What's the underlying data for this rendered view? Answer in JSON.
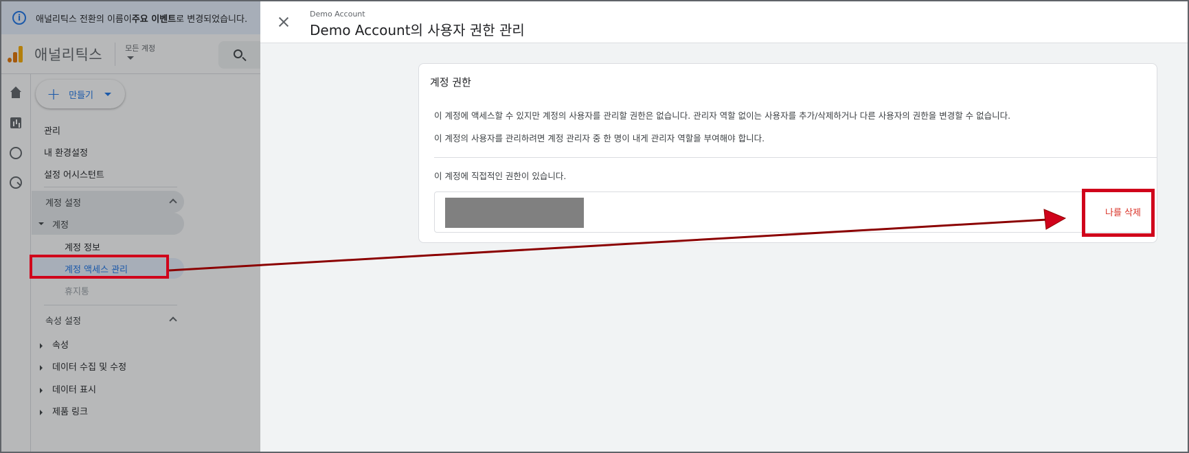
{
  "banner": {
    "text_before": "애널리틱스 전환의 이름이 ",
    "text_bold": "주요 이벤트",
    "text_after": "로 변경되었습니다."
  },
  "topbar": {
    "app_name": "애널리틱스",
    "account_selector_label": "모든 계정"
  },
  "create_button": {
    "label": "만들기"
  },
  "sidebar": {
    "admin": "관리",
    "my_preferences": "내 환경설정",
    "setup_assistant": "설정 어시스턴트",
    "account_settings": "계정 설정",
    "account": "계정",
    "account_details": "계정 정보",
    "account_access_management": "계정 액세스 관리",
    "trash": "휴지통",
    "property_settings": "속성 설정",
    "property": "속성",
    "data_collection": "데이터 수집 및 수정",
    "data_display": "데이터 표시",
    "product_links": "제품 링크"
  },
  "panel": {
    "subtitle": "Demo Account",
    "title": "Demo Account의 사용자 권한 관리"
  },
  "card": {
    "title": "계정 권한",
    "line1": "이 계정에 액세스할 수 있지만 계정의 사용자를 관리할 권한은 없습니다. 관리자 역할 없이는 사용자를 추가/삭제하거나 다른 사용자의 권한을 변경할 수 없습니다.",
    "line2": "이 계정의 사용자를 관리하려면 계정 관리자 중 한 명이 내게 관리자 역할을 부여해야 합니다.",
    "direct_permission": "이 계정에 직접적인 권한이 있습니다.",
    "remove_me": "나를 삭제"
  },
  "colors": {
    "highlight_red": "#d0021b",
    "link_red": "#d93025",
    "accent_blue": "#1a73e8"
  }
}
